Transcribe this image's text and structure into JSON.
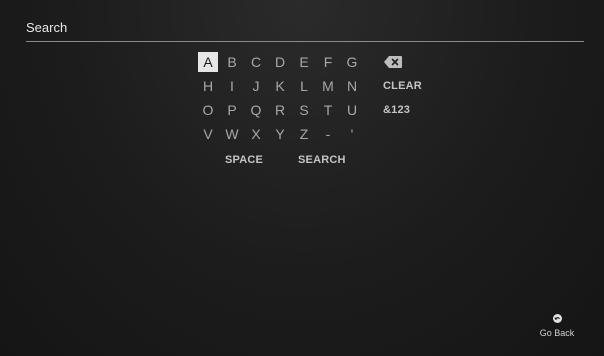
{
  "search": {
    "label": "Search"
  },
  "keyboard": {
    "rows": [
      [
        "A",
        "B",
        "C",
        "D",
        "E",
        "F",
        "G"
      ],
      [
        "H",
        "I",
        "J",
        "K",
        "L",
        "M",
        "N"
      ],
      [
        "O",
        "P",
        "Q",
        "R",
        "S",
        "T",
        "U"
      ],
      [
        "V",
        "W",
        "X",
        "Y",
        "Z",
        "-",
        "'"
      ]
    ],
    "focused_key": "A",
    "backspace_icon": "backspace-icon",
    "clear_label": "CLEAR",
    "symbols_label": "&123",
    "space_label": "SPACE",
    "search_label": "SEARCH"
  },
  "footer": {
    "go_back_label": "Go Back",
    "go_back_icon": "back-button-icon"
  },
  "colors": {
    "background": "#1c1c1c",
    "focus_highlight": "#e6e6e6",
    "key_text": "#a8a8a8"
  }
}
